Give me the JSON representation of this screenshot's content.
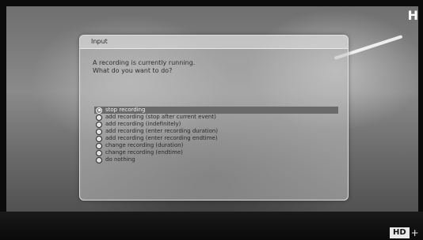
{
  "dialog": {
    "title": "Input",
    "message_lines": [
      "A recording is currently running.",
      "What do you want to do?"
    ],
    "options": [
      {
        "label": "stop recording",
        "selected": true
      },
      {
        "label": "add recording (stop after current event)",
        "selected": false
      },
      {
        "label": "add recording (indefinitely)",
        "selected": false
      },
      {
        "label": "add recording (enter recording duration)",
        "selected": false
      },
      {
        "label": "add recording (enter recording endtime)",
        "selected": false
      },
      {
        "label": "change recording (duration)",
        "selected": false
      },
      {
        "label": "change recording (endtime)",
        "selected": false
      },
      {
        "label": "do nothing",
        "selected": false
      }
    ]
  },
  "overlay": {
    "corner_text": "H",
    "hd_badge": "HD",
    "hd_plus": "+"
  }
}
